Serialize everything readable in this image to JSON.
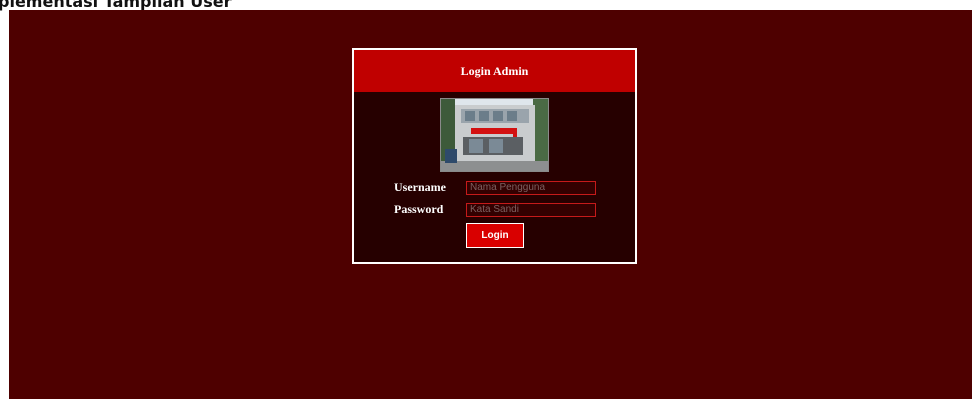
{
  "document": {
    "heading": "plementasi Tampilan User"
  },
  "login": {
    "title": "Login Admin",
    "username_label": "Username",
    "username_placeholder": "Nama Pengguna",
    "password_label": "Password",
    "password_placeholder": "Kata Sandi",
    "submit_label": "Login"
  },
  "colors": {
    "page_background": "#4e0000",
    "panel_background": "#260000",
    "header_red": "#c00000",
    "button_red": "#d90000",
    "input_border": "#c51a1a"
  }
}
